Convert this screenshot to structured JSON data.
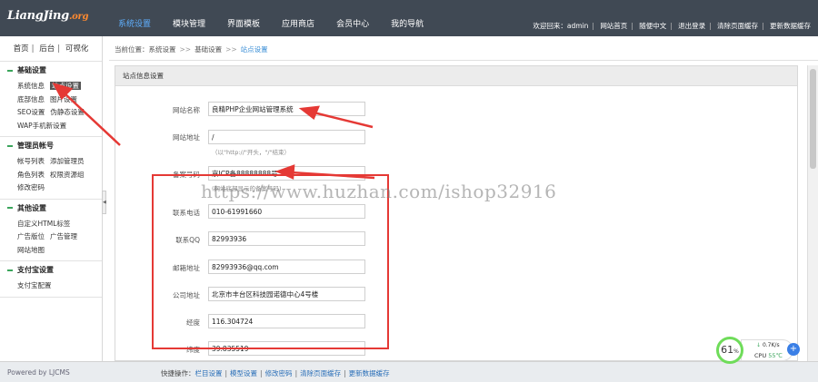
{
  "brand": {
    "logo_main": "LiangJing",
    "logo_suffix": ".org"
  },
  "nav": {
    "items": [
      {
        "label": "系统设置",
        "active": true
      },
      {
        "label": "模块管理",
        "active": false
      },
      {
        "label": "界面模板",
        "active": false
      },
      {
        "label": "应用商店",
        "active": false
      },
      {
        "label": "会员中心",
        "active": false
      },
      {
        "label": "我的导航",
        "active": false
      }
    ],
    "welcome": "欢迎回来：admin",
    "links": [
      "网站首页",
      "随便中文",
      "退出登录",
      "清除页面缓存",
      "更新数据缓存"
    ]
  },
  "sidebar": {
    "quick": [
      "首页",
      "后台",
      "可视化"
    ],
    "groups": [
      {
        "title": "基础设置",
        "rows": [
          [
            "系统信息",
            "站点设置"
          ],
          [
            "底部信息",
            "图片设置"
          ],
          [
            "SEO设置",
            "伪静态设置"
          ],
          [
            "WAP手机新设置"
          ]
        ]
      },
      {
        "title": "管理员帐号",
        "rows": [
          [
            "帐号列表",
            "添加管理员"
          ],
          [
            "角色列表",
            "权限资源组"
          ],
          [
            "修改密码"
          ]
        ]
      },
      {
        "title": "其他设置",
        "rows": [
          [
            "自定义HTML标签"
          ],
          [
            "广告版位",
            "广告管理"
          ],
          [
            "网站地图"
          ]
        ]
      },
      {
        "title": "支付宝设置",
        "rows": [
          [
            "支付宝配置"
          ]
        ]
      }
    ],
    "highlighted": "站点设置"
  },
  "breadcrumb": {
    "prefix": "当前位置：",
    "items": [
      "系统设置",
      "基础设置",
      "站点设置"
    ],
    "separator": ">>"
  },
  "panel": {
    "title": "站点信息设置",
    "fields": [
      {
        "label": "网站名称",
        "value": "良精PHP企业网站管理系统"
      },
      {
        "label": "网站地址",
        "value": "/",
        "hint": "（以\"http://\"开头，\"/\"结束）"
      },
      {
        "label": "备案号码",
        "value": "京ICP备88888888号",
        "hint": "(网站底部显示的备案号码)"
      },
      {
        "label": "联系电话",
        "value": "010-61991660"
      },
      {
        "label": "联系QQ",
        "value": "82993936"
      },
      {
        "label": "邮箱地址",
        "value": "82993936@qq.com"
      },
      {
        "label": "公司地址",
        "value": "北京市丰台区科技园诺德中心4号楼"
      },
      {
        "label": "经度",
        "value": "116.304724"
      },
      {
        "label": "纬度",
        "value": "39.835519"
      }
    ]
  },
  "watermark": "https://www.huzhan.com/ishop32916",
  "footer": {
    "powered": "Powered by LJCMS",
    "quick_label": "快捷操作：",
    "ops": [
      "栏目设置",
      "模型设置",
      "修改密码",
      "清除页面缓存",
      "更新数据缓存"
    ]
  },
  "widget": {
    "cpu_percent": "61",
    "percent_sign": "%",
    "speed": "0.7K/s",
    "cpu_label": "CPU",
    "cpu_temp": "55℃",
    "plus": "+"
  },
  "colors": {
    "topbar": "#404954",
    "nav_active": "#5fb0ff",
    "annotation_red": "#e53935",
    "link_blue": "#2a6fb8"
  }
}
